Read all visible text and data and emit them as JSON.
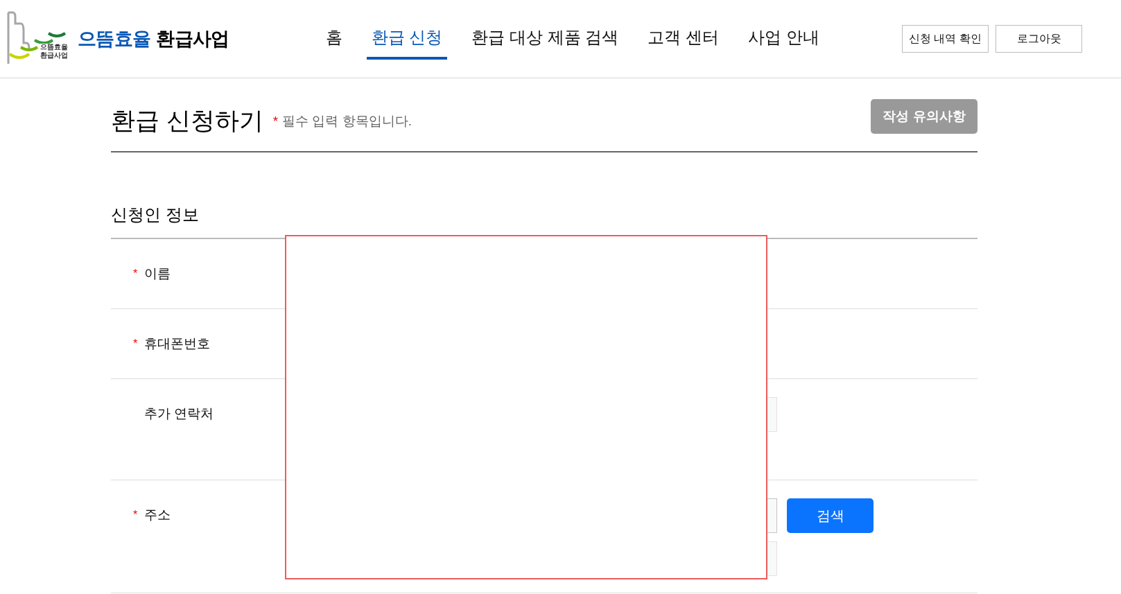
{
  "logo": {
    "mark_line_1": "으뜸효율",
    "mark_line_2": "환급사업",
    "brand": "으뜸효율",
    "brand_suffix": "환급사업"
  },
  "nav": [
    {
      "label": "홈",
      "selected": false
    },
    {
      "label": "환급 신청",
      "selected": true
    },
    {
      "label": "환급 대상 제품 검색",
      "selected": false
    },
    {
      "label": "고객 센터",
      "selected": false
    },
    {
      "label": "사업 안내",
      "selected": false
    }
  ],
  "header_buttons": [
    "신청 내역 확인",
    "로그아웃"
  ],
  "page": {
    "title": "환급 신청하기",
    "required_mark": "*",
    "required_note": "필수 입력 항목입니다.",
    "notice_button": "작성 유의사항"
  },
  "section": {
    "title": "신청인 정보",
    "rows": [
      {
        "kind": "single",
        "label": "이름",
        "required": true
      },
      {
        "kind": "single",
        "label": "휴대폰번호",
        "required": true
      },
      {
        "kind": "field",
        "label": "추가 연락처",
        "required": false
      },
      {
        "kind": "address",
        "label": "주소",
        "required": true,
        "button": "검색"
      }
    ]
  }
}
